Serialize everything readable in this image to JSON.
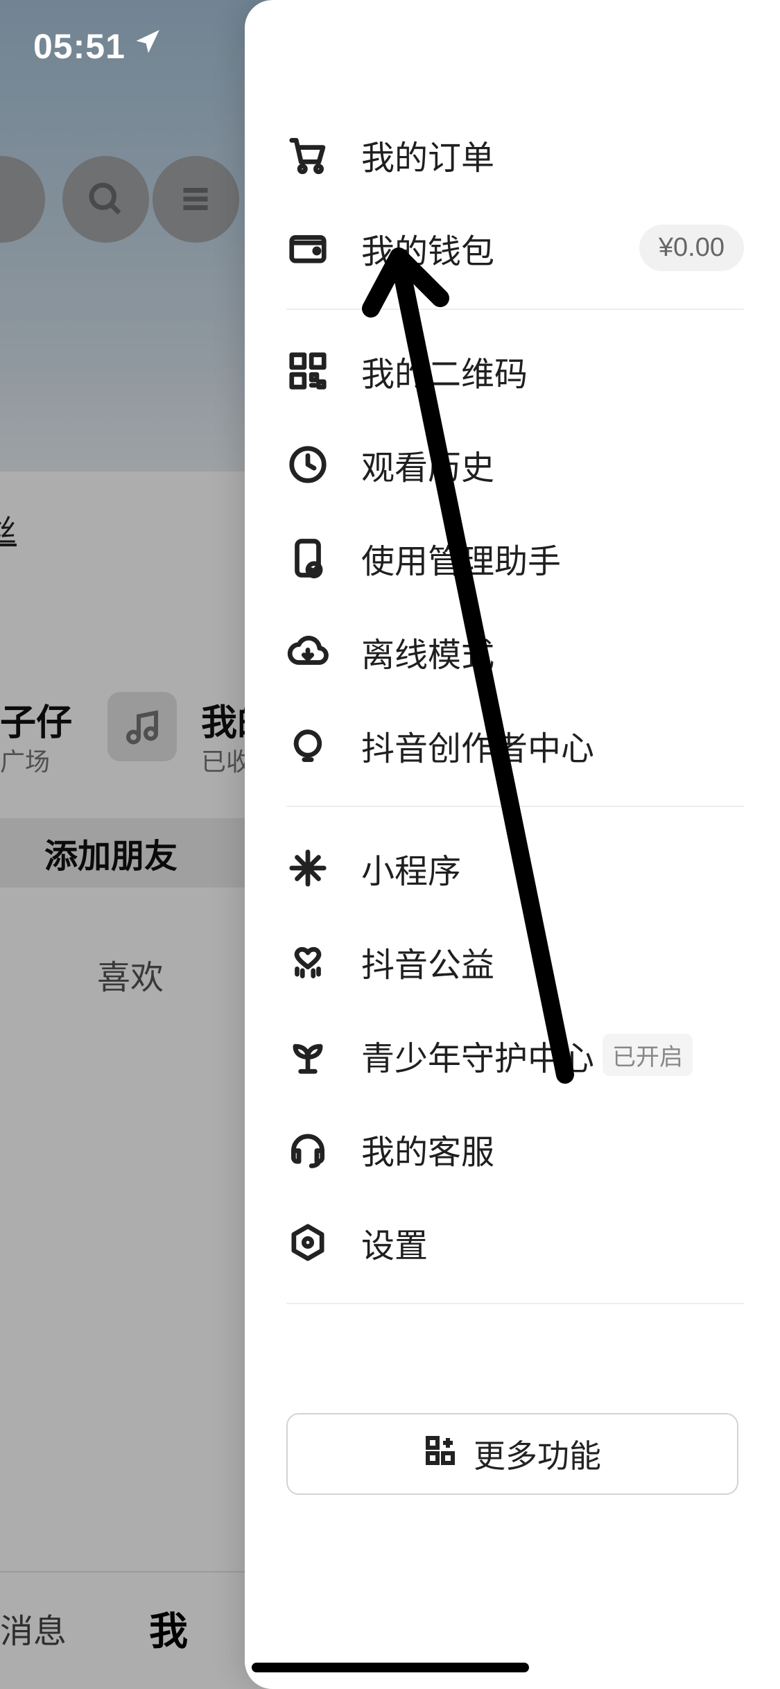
{
  "status": {
    "time": "05:51"
  },
  "bg": {
    "fans": "丝",
    "card": {
      "title_left": "子仔",
      "sub_left": "广场",
      "title_right": "我的",
      "sub_right": "已收"
    },
    "add_friend": "添加朋友",
    "like": "喜欢",
    "tab_msg": "消息",
    "tab_me": "我"
  },
  "drawer": {
    "orders": "我的订单",
    "wallet": "我的钱包",
    "wallet_amount": "¥0.00",
    "qrcode": "我的二维码",
    "history": "观看历史",
    "assistant": "使用管理助手",
    "offline": "离线模式",
    "creator": "抖音创作者中心",
    "miniapp": "小程序",
    "charity": "抖音公益",
    "teen": "青少年守护中心",
    "teen_tag": "已开启",
    "service": "我的客服",
    "settings": "设置",
    "more": "更多功能"
  }
}
